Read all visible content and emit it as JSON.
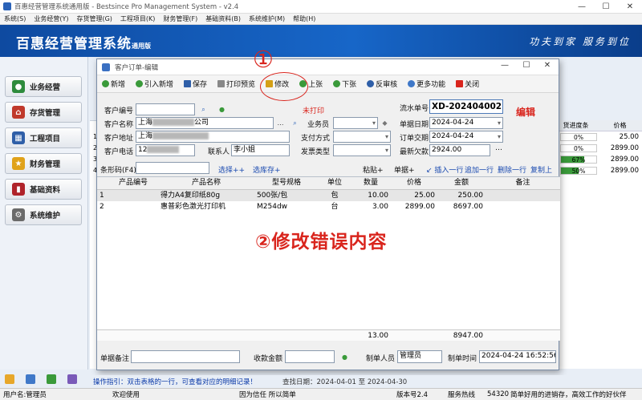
{
  "window": {
    "title": "百惠经营管理系统通用版 - Bestsince Pro Management System - v2.4",
    "controls": {
      "minimize": "—",
      "maximize": "☐",
      "close": "✕"
    }
  },
  "menu": [
    "系统(S)",
    "业务经营(Y)",
    "存货管理(G)",
    "工程项目(K)",
    "财务管理(F)",
    "基础资料(B)",
    "系统维护(M)",
    "帮助(H)"
  ],
  "banner": {
    "brand": "百惠经营管理系统",
    "edition": "通用版",
    "slogan": "功夫到家 服务到位"
  },
  "sidebar": {
    "items": [
      {
        "label": "业务经营",
        "icon": "business-icon",
        "color": "#2e8b3c"
      },
      {
        "label": "存货管理",
        "icon": "warehouse-icon",
        "color": "#c0392b"
      },
      {
        "label": "工程项目",
        "icon": "project-icon",
        "color": "#2f5fa8"
      },
      {
        "label": "财务管理",
        "icon": "finance-icon",
        "color": "#e0a21a"
      },
      {
        "label": "基础资料",
        "icon": "book-icon",
        "color": "#b0232a"
      },
      {
        "label": "系统维护",
        "icon": "gear-icon",
        "color": "#6a6a6a"
      }
    ]
  },
  "background_grid": {
    "headers": [
      "货进度条",
      "价格"
    ],
    "rows": [
      {
        "no": "1",
        "progress_text": "0%",
        "progress": 0,
        "price": "25.00"
      },
      {
        "no": "2",
        "progress_text": "0%",
        "progress": 0,
        "price": "2899.00"
      },
      {
        "no": "3",
        "progress_text": "67%",
        "progress": 0.67,
        "price": "2899.00"
      },
      {
        "no": "4",
        "progress_text": "50%",
        "progress": 0.5,
        "price": "2899.00"
      }
    ]
  },
  "dialog": {
    "title": "客户订单-编辑",
    "toolbar": {
      "new": "新增",
      "quote_new": "引入新增",
      "save": "保存",
      "print_preview": "打印预览",
      "modify": "修改",
      "prev": "上张",
      "next": "下张",
      "unapprove": "反审核",
      "more": "更多功能",
      "close": "关闭"
    },
    "form": {
      "customer_code_label": "客户编号",
      "customer_name_label": "客户名称",
      "customer_name_prefix": "上海",
      "customer_name_suffix": "公司",
      "customer_addr_label": "客户地址",
      "customer_addr_value": "上海",
      "customer_phone_label": "客户电话",
      "customer_phone_value": "12",
      "contact_label": "联系人",
      "contact_value": "李小姐",
      "print_status": "未打印",
      "salesperson_label": "业务员",
      "payment_label": "支付方式",
      "invoice_label": "发票类型",
      "serial_label": "流水单号",
      "serial_value": "XD-202404002",
      "doc_date_label": "单据日期",
      "doc_date_value": "2024-04-24",
      "order_date_label": "订单交期",
      "order_date_value": "2024-04-24",
      "latest_debt_label": "最新欠款",
      "latest_debt_value": "2924.00",
      "barcode_label": "条形码(F4)",
      "select_plus": "选择++",
      "select_stock_plus": "选库存+",
      "paste_plus": "粘贴+",
      "doc_plus": "单据+",
      "insert_row": "插入一行",
      "append_row": "追加一行",
      "delete_row": "删除一行",
      "copy_prev": "复制上行"
    },
    "grid": {
      "headers": {
        "code": "产品编号",
        "name": "产品名称",
        "spec": "型号规格",
        "unit": "单位",
        "qty": "数量",
        "price": "价格",
        "amount": "金额",
        "note": "备注"
      },
      "rows": [
        {
          "no": "1",
          "code": "",
          "name": "得力A4复印纸80g",
          "spec": "500张/包",
          "unit": "包",
          "qty": "10.00",
          "price": "25.00",
          "amount": "250.00",
          "note": ""
        },
        {
          "no": "2",
          "code": "",
          "name": "惠普彩色激光打印机",
          "spec": "M254dw",
          "unit": "台",
          "qty": "3.00",
          "price": "2899.00",
          "amount": "8697.00",
          "note": ""
        }
      ],
      "totals": {
        "qty": "13.00",
        "amount": "8947.00"
      }
    },
    "bottom": {
      "remark_label": "单据备注",
      "received_label": "收款金额",
      "maker_label": "制单人员",
      "maker_value": "管理员",
      "make_time_label": "制单时间",
      "make_time_value": "2024-04-24 16:52:56"
    }
  },
  "annotations": {
    "step_one": "①",
    "edit_note": "编辑",
    "step_two": "②修改错误内容"
  },
  "statusbar": {
    "tip": "操作指引：双击表格的一行，可查看对应的明细记录！",
    "date_range": "查找日期：2024-04-01 至 2024-04-30",
    "user": "用户名:管理员",
    "welcome": "欢迎使用",
    "motto": "因为信任 所以简单",
    "version": "版本号2.4",
    "service_label": "服务热线",
    "service_number": "54320",
    "slogan": "简单好用的进销存，高效工作的好伙伴"
  }
}
